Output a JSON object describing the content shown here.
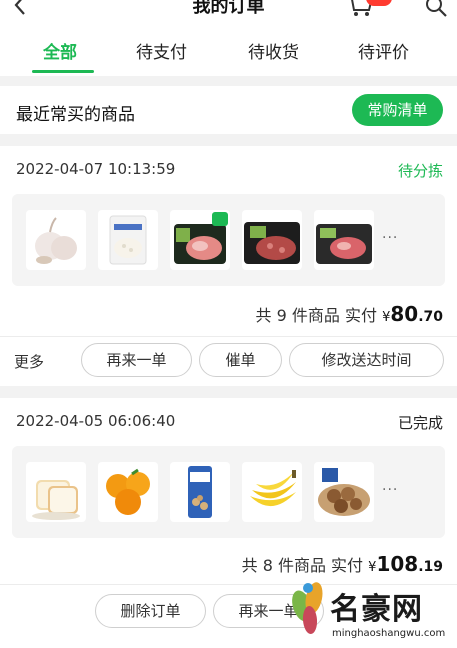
{
  "header": {
    "title": "我的订单",
    "cart_badge": "",
    "icons": [
      "back-arrow-icon",
      "cart-icon",
      "search-icon"
    ]
  },
  "tabs": [
    {
      "label": "全部",
      "active": true
    },
    {
      "label": "待支付",
      "active": false
    },
    {
      "label": "待收货",
      "active": false
    },
    {
      "label": "待评价",
      "active": false
    }
  ],
  "frequent": {
    "label": "最近常买的商品",
    "button": "常购清单"
  },
  "orders": [
    {
      "datetime": "2022-04-07 10:13:59",
      "status": "待分拣",
      "status_color": "#1db954",
      "items": [
        "garlic",
        "rice-pack",
        "pork-tray-tagged",
        "ground-meat-tray",
        "meat-tray"
      ],
      "more": "···",
      "summary_prefix": "共 9 件商品 实付",
      "currency": "¥",
      "amount_int": "80",
      "amount_dec": ".70",
      "more_label": "更多",
      "actions": [
        "再来一单",
        "催单",
        "修改送达时间"
      ]
    },
    {
      "datetime": "2022-04-05 06:06:40",
      "status": "已完成",
      "status_color": "#222222",
      "items": [
        "bread",
        "oranges",
        "bagged-snack",
        "bananas",
        "dumplings"
      ],
      "more": "···",
      "summary_prefix": "共 8 件商品 实付",
      "currency": "¥",
      "amount_int": "108",
      "amount_dec": ".19",
      "actions": [
        "删除订单",
        "再来一单"
      ]
    }
  ],
  "watermark": {
    "title": "名豪网",
    "url": "minghaoshangwu.com"
  },
  "colors": {
    "accent": "#1db954",
    "badge": "#ff3b30"
  }
}
